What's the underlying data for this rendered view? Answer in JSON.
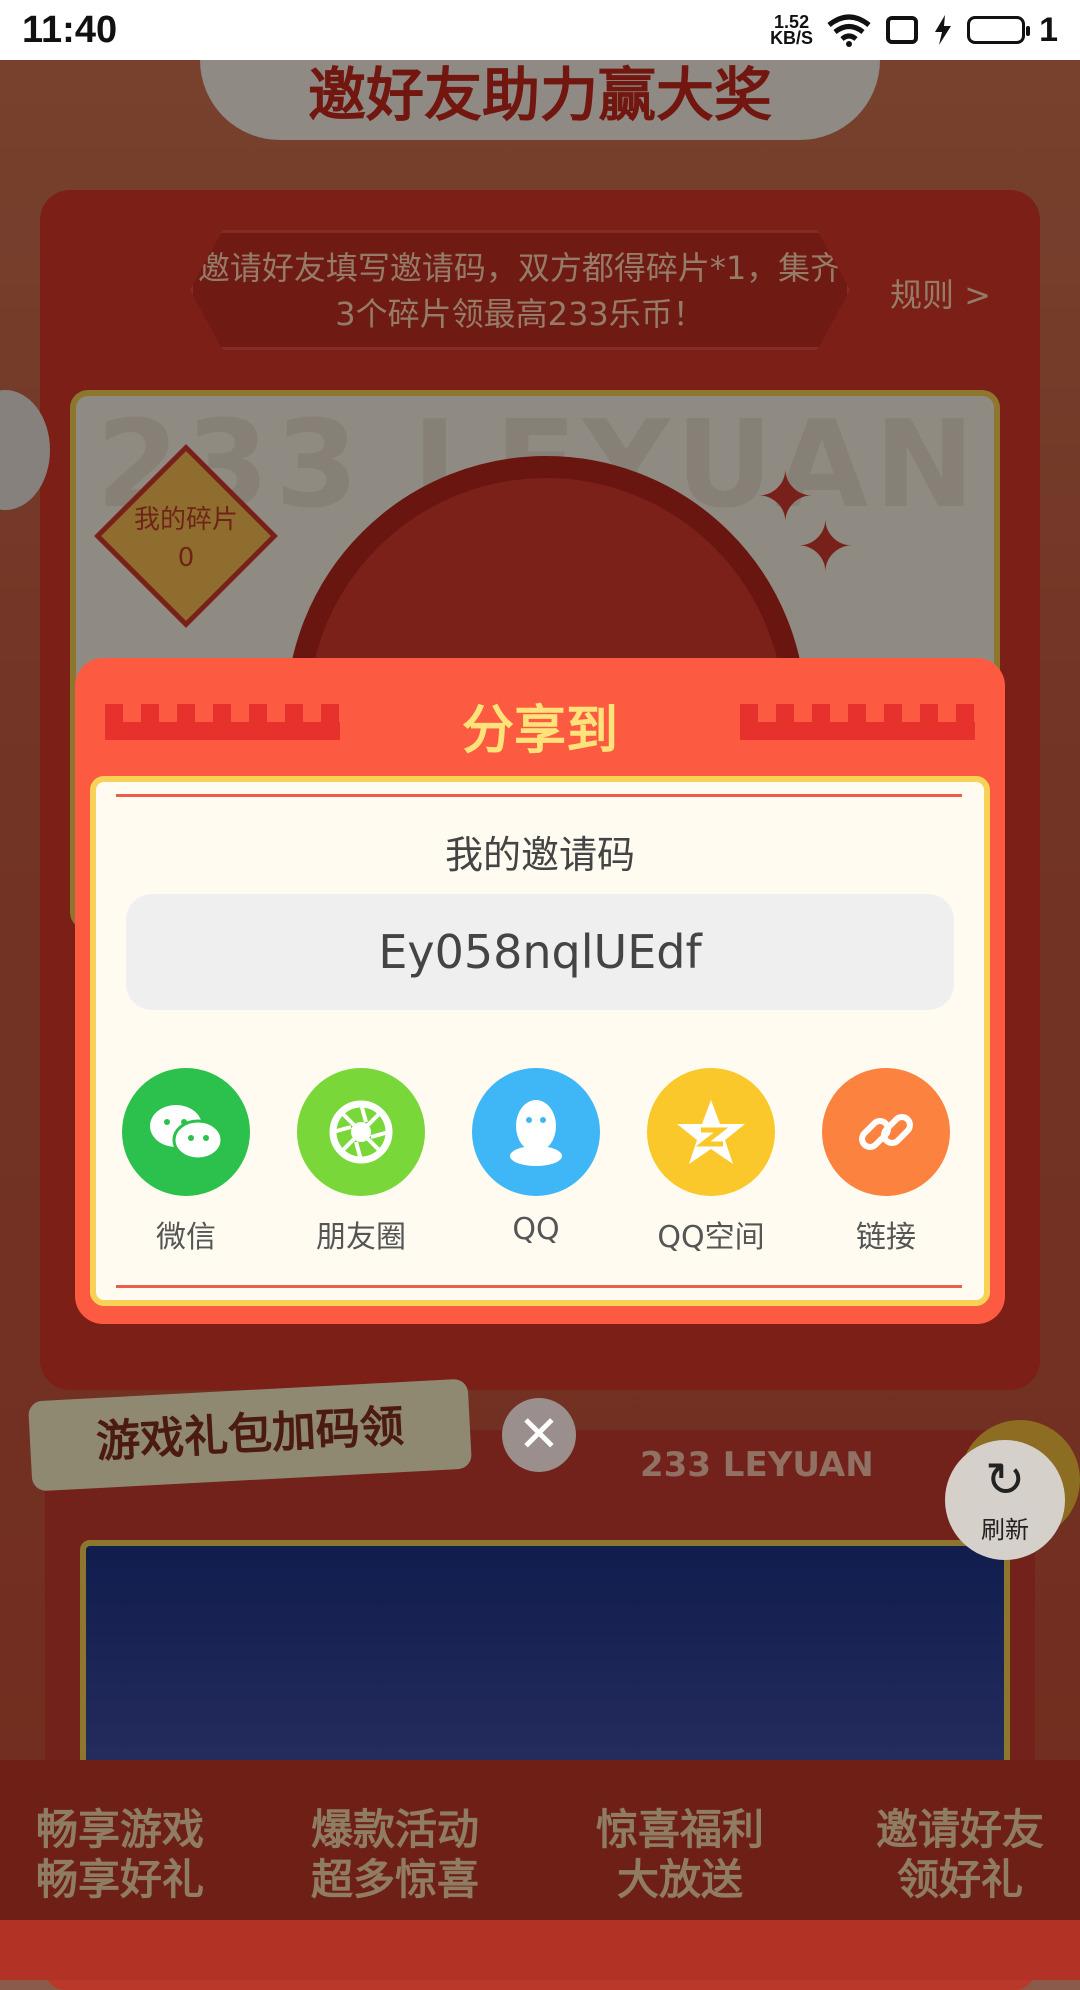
{
  "status_bar": {
    "time": "11:40",
    "net_speed_value": "1.52",
    "net_speed_unit": "KB/S",
    "battery": "1"
  },
  "background": {
    "banner_title": "邀好友助力赢大奖",
    "tip": "邀请好友填写邀请码，双方都得碎片*1，集齐3个碎片领最高233乐币！",
    "rules": "规则 >",
    "watermark": "233 LEYUAN",
    "fragments_label": "我的碎片",
    "fragments_count": "0",
    "gift_section_title": "游戏礼包加码领",
    "leyuan_label": "233 LEYUAN",
    "features": [
      "畅享游戏 畅享好礼",
      "爆款活动 超多惊喜",
      "惊喜福利 大放送",
      "邀请好友 领好礼"
    ]
  },
  "refresh_button": {
    "label": "刷新",
    "icon": "refresh-icon"
  },
  "share_modal": {
    "title": "分享到",
    "code_label": "我的邀请码",
    "code_value": "Ey058nqlUEdf",
    "targets": [
      {
        "label": "微信",
        "icon": "wechat-icon",
        "color": "#2cc14c"
      },
      {
        "label": "朋友圈",
        "icon": "moments-icon",
        "color": "#7ad73a"
      },
      {
        "label": "QQ",
        "icon": "qq-icon",
        "color": "#3fb6f6"
      },
      {
        "label": "QQ空间",
        "icon": "qzone-icon",
        "color": "#fbc82b"
      },
      {
        "label": "链接",
        "icon": "link-icon",
        "color": "#fc8240"
      }
    ],
    "close_icon": "close-icon"
  }
}
